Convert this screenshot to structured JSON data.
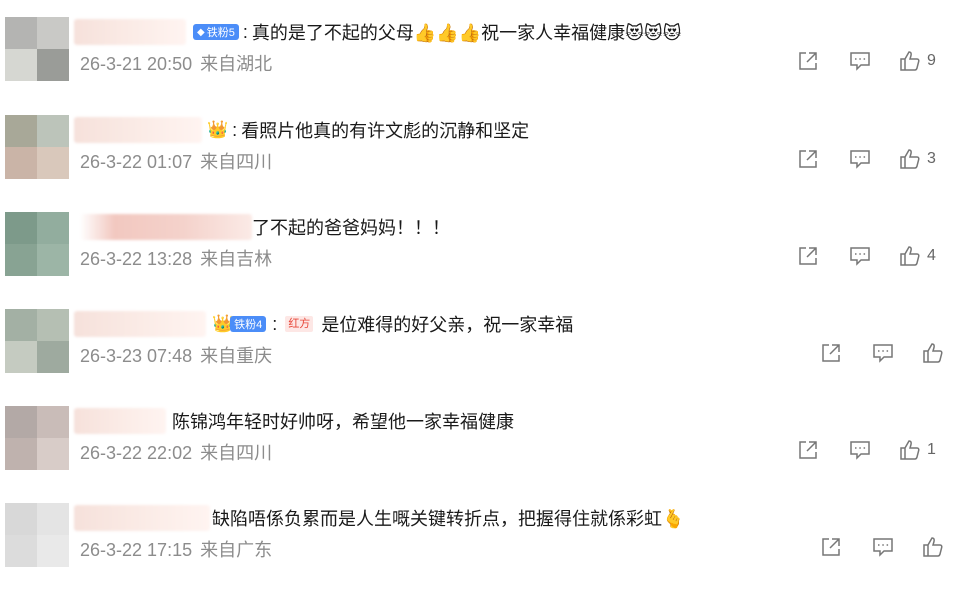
{
  "comments": [
    {
      "badge": "铁粉5",
      "text": "真的是了不起的父母👍👍👍祝一家人幸福健康😻😻😻",
      "time": "26-3-21 20:50",
      "location": "来自湖北",
      "likes": "9",
      "avatar_colors": [
        "#b4b4b2",
        "#c9c9c6",
        "#d6d7d2",
        "#9a9c98"
      ]
    },
    {
      "text": "看照片他真的有许文彪的沉静和坚定",
      "time": "26-3-22 01:07",
      "location": "来自四川",
      "likes": "3",
      "avatar_colors": [
        "#a8a898",
        "#bcc4ba",
        "#cab4a7",
        "#d9c8bb"
      ]
    },
    {
      "text": "了不起的爸爸妈妈！！！",
      "time": "26-3-22 13:28",
      "location": "来自吉林",
      "likes": "4",
      "avatar_colors": [
        "#7d9a8a",
        "#92ad9e",
        "#88a393",
        "#9cb5a6"
      ]
    },
    {
      "badge": "铁粉4",
      "tag": "红方",
      "text": "是位难得的好父亲，祝一家幸福",
      "time": "26-3-23 07:48",
      "location": "来自重庆",
      "likes": "",
      "avatar_colors": [
        "#a3b0a4",
        "#b5bfb3",
        "#c5cbc1",
        "#9eaa9f"
      ]
    },
    {
      "text": "陈锦鸿年轻时好帅呀，希望他一家幸福健康",
      "time": "26-3-22 22:02",
      "location": "来自四川",
      "likes": "1",
      "avatar_colors": [
        "#b3a9a6",
        "#c9bcb8",
        "#bfb2ae",
        "#d8ccc8"
      ]
    },
    {
      "text": "缺陷唔係负累而是人生嘅关键转折点，把握得住就係彩虹🫰",
      "time": "26-3-22 17:15",
      "location": "来自广东",
      "likes": "",
      "avatar_colors": [
        "#d8d8d8",
        "#e4e4e4",
        "#dcdcdc",
        "#e9e9e9"
      ]
    }
  ]
}
